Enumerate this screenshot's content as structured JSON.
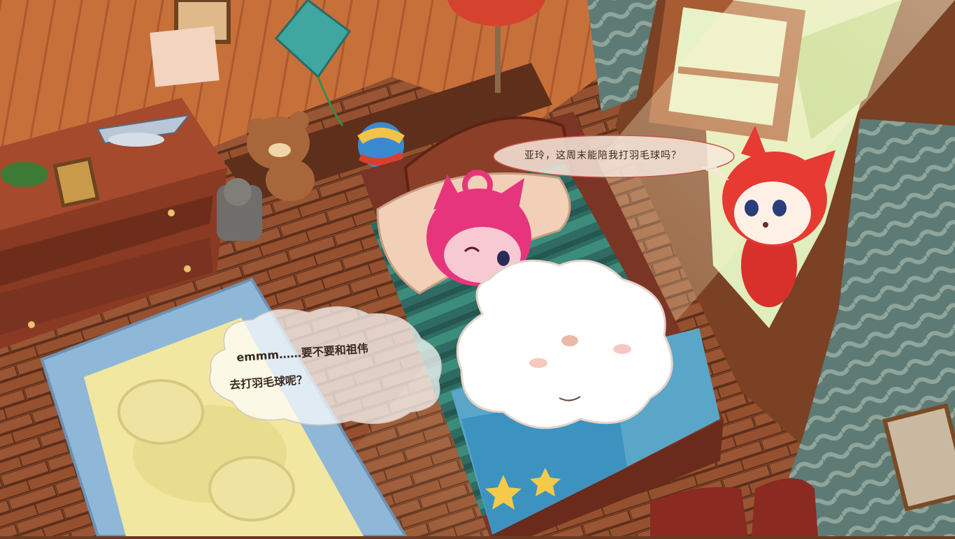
{
  "scene": {
    "description_tag": "bedroom-scene"
  },
  "dialogue": {
    "top_bubble": "亚玲，这周末能陪我打羽毛球吗？",
    "thought_line1": "emmm……要不要和祖伟",
    "thought_line2": "去打羽毛球呢？"
  },
  "colors": {
    "wall": "#c8703a",
    "floor": "#8a4a2a",
    "rug_blue": "#8fb7d8",
    "rug_yellow": "#f1e7a0",
    "bed_frame": "#7a3524",
    "blanket_green": "#2f6b62",
    "pink_fox": "#e6357d",
    "red_fox": "#e63a33",
    "window_light": "#e8f2c8",
    "curtain": "#7e8e86"
  }
}
